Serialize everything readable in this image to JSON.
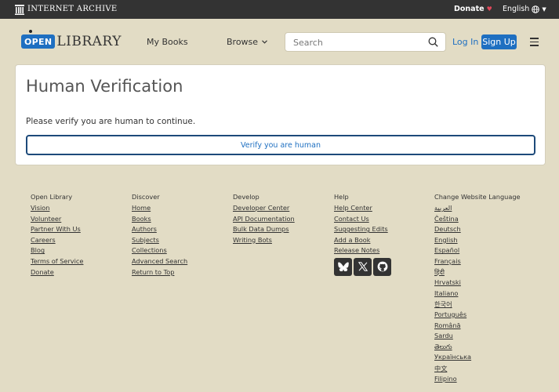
{
  "ia_bar": {
    "brand": "INTERNET ARCHIVE",
    "donate": "Donate",
    "donate_heart": "♥",
    "language": "English"
  },
  "header": {
    "logo_open": "OPEN",
    "logo_library": "LIBRARY",
    "my_books": "My Books",
    "browse": "Browse",
    "search_placeholder": "Search",
    "login": "Log In",
    "signup": "Sign Up"
  },
  "main": {
    "title": "Human Verification",
    "message": "Please verify you are human to continue.",
    "verify_button": "Verify you are human"
  },
  "footer": {
    "open_library": {
      "heading": "Open Library",
      "links": [
        "Vision",
        "Volunteer",
        "Partner With Us",
        "Careers",
        "Blog",
        "Terms of Service",
        "Donate"
      ]
    },
    "discover": {
      "heading": "Discover",
      "links": [
        "Home",
        "Books",
        "Authors",
        "Subjects",
        "Collections",
        "Advanced Search",
        "Return to Top"
      ]
    },
    "develop": {
      "heading": "Develop",
      "links": [
        "Developer Center",
        "API Documentation",
        "Bulk Data Dumps",
        "Writing Bots"
      ]
    },
    "help": {
      "heading": "Help",
      "links": [
        "Help Center",
        "Contact Us",
        "Suggesting Edits",
        "Add a Book",
        "Release Notes"
      ]
    },
    "language": {
      "heading": "Change Website Language",
      "links": [
        "العربية",
        "Čeština",
        "Deutsch",
        "English",
        "Español",
        "Français",
        "हिंदी",
        "Hrvatski",
        "Italiano",
        "한국어",
        "Português",
        "Română",
        "Sardu",
        "తెలుగు",
        "Українська",
        "中文",
        "Filipino"
      ]
    }
  },
  "colors": {
    "brand_blue": "#1e6fc1",
    "background": "#e2dcc5",
    "top_bar": "#333333",
    "verify_border": "#1d4a7a"
  }
}
